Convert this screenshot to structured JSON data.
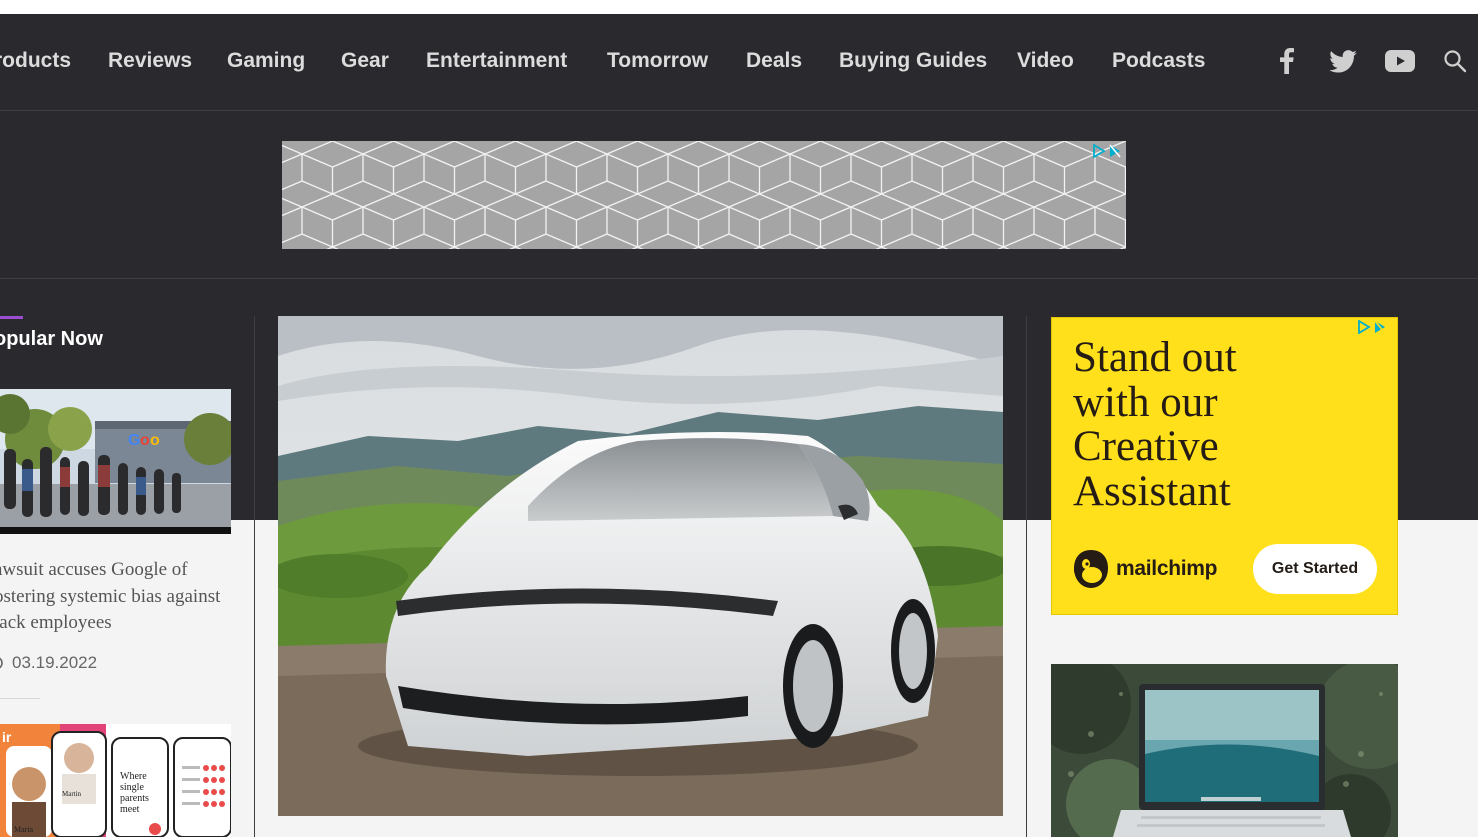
{
  "nav": {
    "items": [
      "roducts",
      "Reviews",
      "Gaming",
      "Gear",
      "Entertainment",
      "Tomorrow",
      "Deals",
      "Buying Guides",
      "Video",
      "Podcasts"
    ],
    "social_icons": [
      "facebook-icon",
      "twitter-icon",
      "youtube-icon",
      "search-icon"
    ]
  },
  "popular": {
    "title": "opular Now",
    "article1": {
      "headline_lines": [
        "awsuit accuses Google of",
        "ostering systemic bias against",
        "lack employees"
      ],
      "date": "03.19.2022"
    },
    "article2": {
      "phone_text": "Where single parents meet",
      "profile_name": "Maria",
      "card_label": "Martin"
    }
  },
  "side_ad": {
    "headline_lines": [
      "Stand out",
      "with our",
      "Creative",
      "Assistant"
    ],
    "brand": "mailchimp",
    "cta": "Get Started"
  },
  "colors": {
    "nav_bg": "#2a2a2e",
    "accent": "#9a4fd3",
    "ad_yellow": "#ffe01b",
    "adchoices_blue": "#00aecd"
  }
}
